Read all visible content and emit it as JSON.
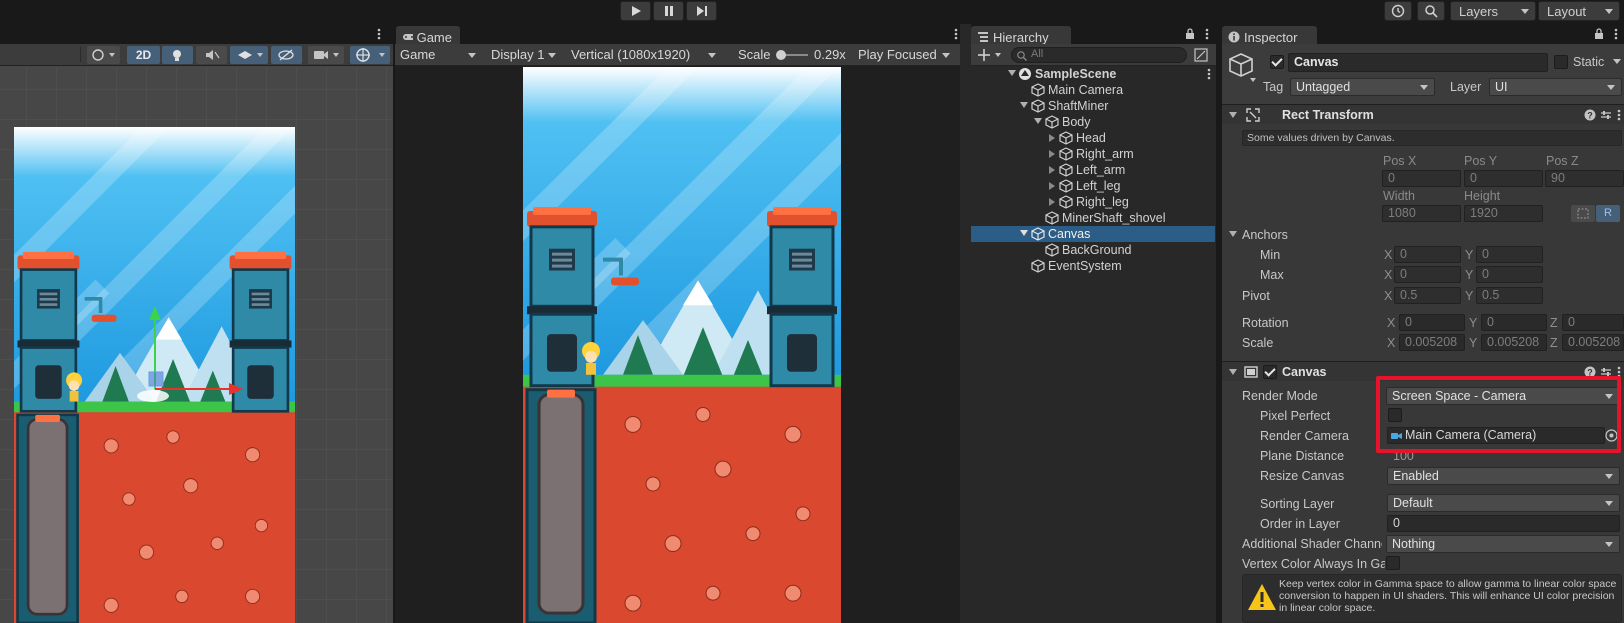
{
  "toolbar": {
    "play_icon": "play-icon",
    "pause_icon": "pause-icon",
    "step_icon": "step-icon",
    "history_icon": "history-icon",
    "search_icon": "search-icon",
    "layers_label": "Layers",
    "layout_label": "Layout"
  },
  "scene_view": {
    "mode_2d": "2D"
  },
  "game_view": {
    "tab": "Game",
    "view_select": "Game",
    "display_select": "Display 1",
    "resolution_select": "Vertical (1080x1920)",
    "scale_label": "Scale",
    "scale_value": "0.29x",
    "play_mode": "Play Focused"
  },
  "hierarchy": {
    "tab": "Hierarchy",
    "search_placeholder": "All",
    "items": [
      {
        "label": "SampleScene"
      },
      {
        "label": "Main Camera"
      },
      {
        "label": "ShaftMiner"
      },
      {
        "label": "Body"
      },
      {
        "label": "Head"
      },
      {
        "label": "Right_arm"
      },
      {
        "label": "Left_arm"
      },
      {
        "label": "Left_leg"
      },
      {
        "label": "Right_leg"
      },
      {
        "label": "MinerShaft_shovel"
      },
      {
        "label": "Canvas"
      },
      {
        "label": "BackGround"
      },
      {
        "label": "EventSystem"
      }
    ]
  },
  "inspector": {
    "tab": "Inspector",
    "object_name": "Canvas",
    "static_label": "Static",
    "tag_label": "Tag",
    "tag_value": "Untagged",
    "layer_label": "Layer",
    "layer_value": "UI",
    "rect_transform": {
      "title": "Rect Transform",
      "note": "Some values driven by Canvas.",
      "pos_x_label": "Pos X",
      "pos_y_label": "Pos Y",
      "pos_z_label": "Pos Z",
      "pos_x": "0",
      "pos_y": "0",
      "pos_z": "90",
      "width_label": "Width",
      "height_label": "Height",
      "width": "1080",
      "height": "1920",
      "r_button": "R",
      "anchors_label": "Anchors",
      "min_label": "Min",
      "max_label": "Max",
      "x_label": "X",
      "y_label": "Y",
      "z_label": "Z",
      "min_x": "0",
      "min_y": "0",
      "max_x": "0",
      "max_y": "0",
      "pivot_label": "Pivot",
      "pivot_x": "0.5",
      "pivot_y": "0.5",
      "rotation_label": "Rotation",
      "rot_x": "0",
      "rot_y": "0",
      "rot_z": "0",
      "scale_label": "Scale",
      "scale_x": "0.005208",
      "scale_y": "0.005208",
      "scale_z": "0.005208"
    },
    "canvas": {
      "title": "Canvas",
      "render_mode_label": "Render Mode",
      "render_mode": "Screen Space - Camera",
      "pixel_perfect_label": "Pixel Perfect",
      "render_camera_label": "Render Camera",
      "render_camera": "Main Camera (Camera)",
      "plane_distance_label": "Plane Distance",
      "plane_distance": "100",
      "resize_canvas_label": "Resize Canvas",
      "resize_canvas": "Enabled",
      "sorting_layer_label": "Sorting Layer",
      "sorting_layer": "Default",
      "order_label": "Order in Layer",
      "order": "0",
      "shader_channels_label": "Additional Shader Channe",
      "shader_channels": "Nothing",
      "vertex_color_label": "Vertex Color Always In Ga",
      "warning": "Keep vertex color in Gamma space to allow gamma to linear color space conversion to happen in UI shaders. This will enhance UI color precision in linear color space."
    }
  },
  "colors": {
    "highlight": "#e8132b",
    "selection": "#2c5d87",
    "sky": "#35a9e8",
    "ground": "#d9482f",
    "grass": "#3cc548"
  }
}
